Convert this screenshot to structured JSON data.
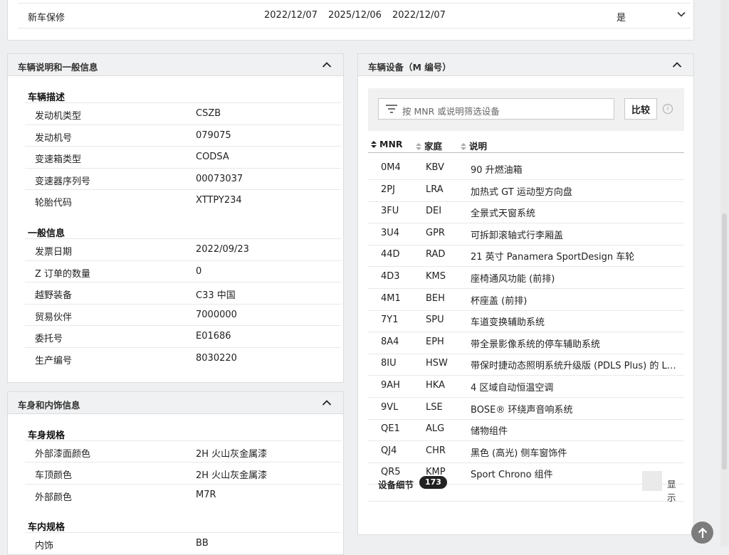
{
  "warranty": {
    "label": "新车保修",
    "date1": "2022/12/07",
    "date2": "2025/12/06",
    "date3": "2022/12/07",
    "flag": "是"
  },
  "vehicle_info": {
    "title": "车辆说明和一般信息",
    "sections": [
      {
        "heading": "车辆描述",
        "rows": [
          {
            "k": "发动机类型",
            "v": "CSZB"
          },
          {
            "k": "发动机号",
            "v": "079075"
          },
          {
            "k": "变速箱类型",
            "v": "CODSA"
          },
          {
            "k": "变速器序列号",
            "v": "00073037"
          },
          {
            "k": "轮胎代码",
            "v": "XTTPY234"
          }
        ]
      },
      {
        "heading": "一般信息",
        "rows": [
          {
            "k": "发票日期",
            "v": "2022/09/23"
          },
          {
            "k": "Z 订单的数量",
            "v": "0"
          },
          {
            "k": "越野装备",
            "v": "C33 中国"
          },
          {
            "k": "贸易伙伴",
            "v": "7000000"
          },
          {
            "k": "委托号",
            "v": "E01686"
          },
          {
            "k": "生产编号",
            "v": "8030220"
          }
        ]
      }
    ]
  },
  "body_info": {
    "title": "车身和内饰信息",
    "sections": [
      {
        "heading": "车身规格",
        "rows": [
          {
            "k": "外部漆面颜色",
            "v": "2H 火山灰金属漆"
          },
          {
            "k": "车顶颜色",
            "v": "2H 火山灰金属漆"
          },
          {
            "k": "外部颜色",
            "v": "M7R"
          }
        ]
      },
      {
        "heading": "车内规格",
        "rows": [
          {
            "k": "内饰",
            "v": "BB"
          }
        ]
      }
    ]
  },
  "equipment": {
    "title": "车辆设备（M 编号）",
    "filter_placeholder": "按 MNR 或说明筛选设备",
    "compare_label": "比较",
    "headers": {
      "mnr": "MNR",
      "family": "家庭",
      "desc": "说明"
    },
    "rows": [
      {
        "mnr": "0M4",
        "family": "KBV",
        "desc": "90 升燃油箱"
      },
      {
        "mnr": "2PJ",
        "family": "LRA",
        "desc": "加热式 GT 运动型方向盘"
      },
      {
        "mnr": "3FU",
        "family": "DEI",
        "desc": "全景式天窗系统"
      },
      {
        "mnr": "3U4",
        "family": "GPR",
        "desc": "可拆卸滚轴式行李厢盖"
      },
      {
        "mnr": "44D",
        "family": "RAD",
        "desc": "21 英寸 Panamera SportDesign 车轮"
      },
      {
        "mnr": "4D3",
        "family": "KMS",
        "desc": "座椅通风功能 (前排)"
      },
      {
        "mnr": "4M1",
        "family": "BEH",
        "desc": "杯座盖 (前排)"
      },
      {
        "mnr": "7Y1",
        "family": "SPU",
        "desc": "车道变换辅助系统"
      },
      {
        "mnr": "8A4",
        "family": "EPH",
        "desc": "带全景影像系统的停车辅助系统"
      },
      {
        "mnr": "8IU",
        "family": "HSW",
        "desc": "带保时捷动态照明系统升级版 (PDLS Plus) 的 LED 矩阵式大灯"
      },
      {
        "mnr": "9AH",
        "family": "HKA",
        "desc": "4 区域自动恒温空调"
      },
      {
        "mnr": "9VL",
        "family": "LSE",
        "desc": "BOSE® 环绕声音响系统"
      },
      {
        "mnr": "QE1",
        "family": "ALG",
        "desc": "储物组件"
      },
      {
        "mnr": "QJ4",
        "family": "CHR",
        "desc": "黑色 (高光) 侧车窗饰件"
      },
      {
        "mnr": "QR5",
        "family": "KMP",
        "desc": "Sport Chrono 组件"
      }
    ],
    "detail_label": "设备细节",
    "count": "173",
    "show_label": "显示"
  }
}
